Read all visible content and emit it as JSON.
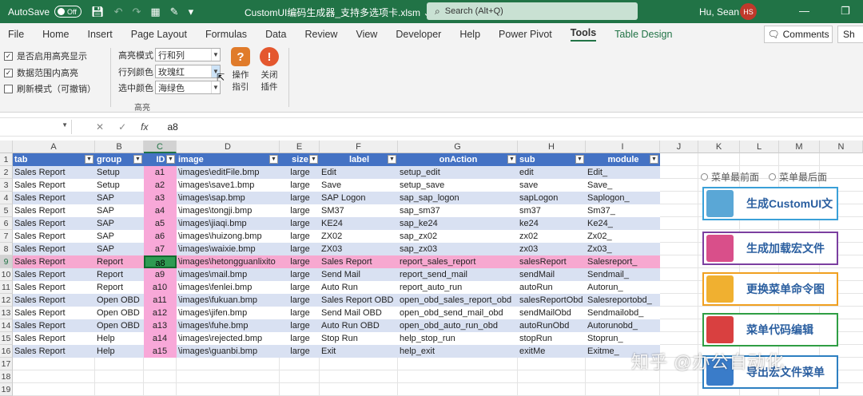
{
  "titlebar": {
    "autosave_label": "AutoSave",
    "autosave_state": "Off",
    "doc_title": "CustomUI编码生成器_支持多选项卡.xlsm ⌄",
    "search_placeholder": "Search (Alt+Q)",
    "user_name": "Hu, Sean",
    "user_initials": "HS"
  },
  "ribbon_tabs": [
    "File",
    "Home",
    "Insert",
    "Page Layout",
    "Formulas",
    "Data",
    "Review",
    "View",
    "Developer",
    "Help",
    "Power Pivot",
    "Tools",
    "Table Design"
  ],
  "active_tab": "Tools",
  "comments_label": "Comments",
  "share_label": "Sh",
  "ribbon": {
    "checkboxes": [
      {
        "label": "是否启用高亮显示",
        "checked": true
      },
      {
        "label": "数据范围内高亮",
        "checked": true
      },
      {
        "label": "刷新模式（可撤销）",
        "checked": false
      }
    ],
    "fields": [
      {
        "label": "高亮模式",
        "value": "行和列"
      },
      {
        "label": "行列颜色",
        "value": "玫瑰红"
      },
      {
        "label": "选中颜色",
        "value": "海绿色"
      }
    ],
    "group_label": "高亮",
    "buttons": [
      {
        "label1": "操作",
        "label2": "指引",
        "glyph": "?"
      },
      {
        "label1": "关闭",
        "label2": "插件",
        "glyph": "!"
      }
    ]
  },
  "formula_bar": {
    "value": "a8"
  },
  "columns": [
    "A",
    "B",
    "C",
    "D",
    "E",
    "F",
    "G",
    "H",
    "I",
    "J",
    "K",
    "L",
    "M",
    "N"
  ],
  "row_numbers": [
    "1",
    "2",
    "3",
    "4",
    "5",
    "6",
    "7",
    "8",
    "9",
    "10",
    "11",
    "12",
    "13",
    "14",
    "15",
    "16",
    "17",
    "18",
    "19"
  ],
  "table": {
    "headers": [
      "tab",
      "group",
      "ID",
      "image",
      "size",
      "label",
      "onAction",
      "sub",
      "module"
    ],
    "rows": [
      [
        "Sales Report",
        "Setup",
        "a1",
        "\\images\\editFile.bmp",
        "large",
        "Edit",
        "setup_edit",
        "edit",
        "Edit_"
      ],
      [
        "Sales Report",
        "Setup",
        "a2",
        "\\images\\save1.bmp",
        "large",
        "Save",
        "setup_save",
        "save",
        "Save_"
      ],
      [
        "Sales Report",
        "SAP",
        "a3",
        "\\images\\sap.bmp",
        "large",
        "SAP Logon",
        "sap_sap_logon",
        "sapLogon",
        "Saplogon_"
      ],
      [
        "Sales Report",
        "SAP",
        "a4",
        "\\images\\tongji.bmp",
        "large",
        "SM37",
        "sap_sm37",
        "sm37",
        "Sm37_"
      ],
      [
        "Sales Report",
        "SAP",
        "a5",
        "\\images\\jiaqi.bmp",
        "large",
        "KE24",
        "sap_ke24",
        "ke24",
        "Ke24_"
      ],
      [
        "Sales Report",
        "SAP",
        "a6",
        "\\images\\huizong.bmp",
        "large",
        "ZX02",
        "sap_zx02",
        "zx02",
        "Zx02_"
      ],
      [
        "Sales Report",
        "SAP",
        "a7",
        "\\images\\waixie.bmp",
        "large",
        "ZX03",
        "sap_zx03",
        "zx03",
        "Zx03_"
      ],
      [
        "Sales Report",
        "Report",
        "a8",
        "\\images\\hetongguanlixito",
        "large",
        "Sales Report",
        "report_sales_report",
        "salesReport",
        "Salesreport_"
      ],
      [
        "Sales Report",
        "Report",
        "a9",
        "\\images\\mail.bmp",
        "large",
        "Send Mail",
        "report_send_mail",
        "sendMail",
        "Sendmail_"
      ],
      [
        "Sales Report",
        "Report",
        "a10",
        "\\images\\fenlei.bmp",
        "large",
        "Auto Run",
        "report_auto_run",
        "autoRun",
        "Autorun_"
      ],
      [
        "Sales Report",
        "Open OBD",
        "a11",
        "\\images\\fukuan.bmp",
        "large",
        "Sales Report OBD",
        "open_obd_sales_report_obd",
        "salesReportObd",
        "Salesreportobd_"
      ],
      [
        "Sales Report",
        "Open OBD",
        "a12",
        "\\images\\jifen.bmp",
        "large",
        "Send Mail OBD",
        "open_obd_send_mail_obd",
        "sendMailObd",
        "Sendmailobd_"
      ],
      [
        "Sales Report",
        "Open OBD",
        "a13",
        "\\images\\fuhe.bmp",
        "large",
        "Auto Run OBD",
        "open_obd_auto_run_obd",
        "autoRunObd",
        "Autorunobd_"
      ],
      [
        "Sales Report",
        "Help",
        "a14",
        "\\images\\rejected.bmp",
        "large",
        "Stop Run",
        "help_stop_run",
        "stopRun",
        "Stoprun_"
      ],
      [
        "Sales Report",
        "Help",
        "a15",
        "\\images\\guanbi.bmp",
        "large",
        "Exit",
        "help_exit",
        "exitMe",
        "Exitme_"
      ]
    ]
  },
  "side_panel": {
    "radio_front": "菜单最前面",
    "radio_back": "菜单最后面",
    "buttons": [
      "生成CustomUI文",
      "生成加载宏文件",
      "更换菜单命令图",
      "菜单代码编辑",
      "导出宏文件菜单"
    ],
    "button_colors": [
      "#3aa0d8",
      "#7b3fa0",
      "#f0a020",
      "#2f9e44",
      "#2d7fc1"
    ]
  },
  "watermark": "知乎 @办公自动化"
}
